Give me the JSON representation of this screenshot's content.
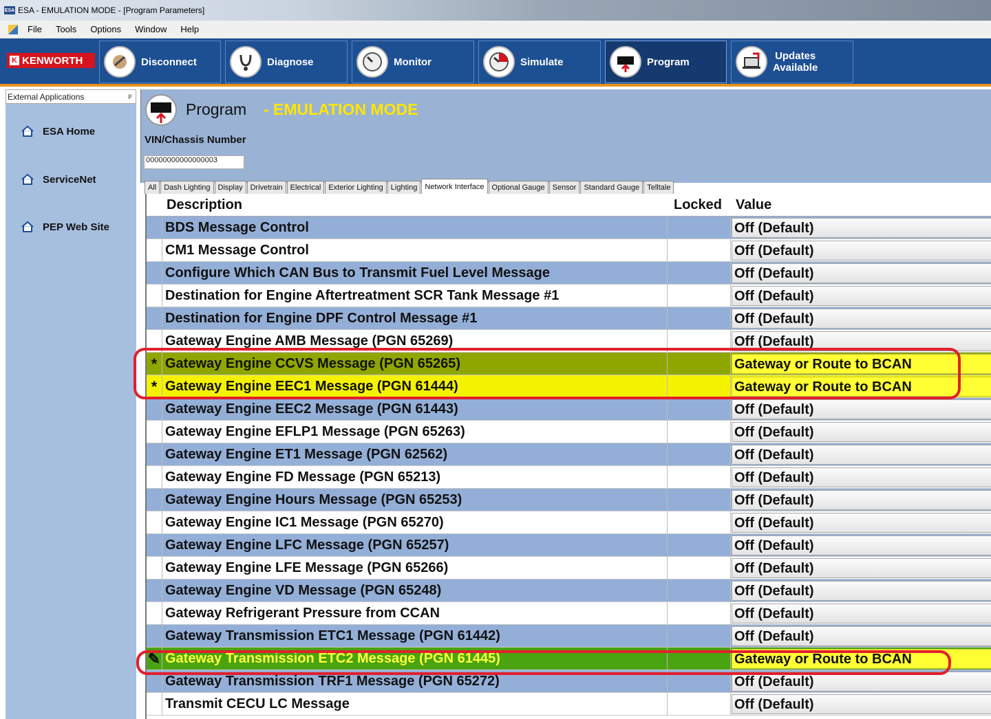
{
  "window": {
    "title": "ESA - EMULATION MODE - [Program Parameters]",
    "app_icon": "ESA"
  },
  "menu": [
    "File",
    "Tools",
    "Options",
    "Window",
    "Help"
  ],
  "toolbar": {
    "brand": "KENWORTH",
    "brand_badge": "K",
    "buttons": [
      {
        "label": "Disconnect",
        "icon": "disconnect-icon"
      },
      {
        "label": "Diagnose",
        "icon": "stethoscope-icon"
      },
      {
        "label": "Monitor",
        "icon": "gauge-icon"
      },
      {
        "label": "Simulate",
        "icon": "simulate-gauge-icon"
      },
      {
        "label": "Program",
        "icon": "chip-icon",
        "active": true
      },
      {
        "label": "Updates Available",
        "label_line1": "Updates",
        "label_line2": "Available",
        "icon": "laptop-update-icon"
      }
    ]
  },
  "sidebar": {
    "header": "External Applications",
    "pin": "ᵖ",
    "links": [
      "ESA Home",
      "ServiceNet",
      "PEP Web Site"
    ]
  },
  "main": {
    "title": "Program",
    "mode": "- EMULATION MODE",
    "vin_label": "VIN/Chassis Number",
    "vin_value": "00000000000000003"
  },
  "tabs": [
    "All",
    "Dash Lighting",
    "Display",
    "Drivetrain",
    "Electrical",
    "Exterior Lighting",
    "Lighting",
    "Network Interface",
    "Optional Gauge",
    "Sensor",
    "Standard Gauge",
    "Telltale"
  ],
  "active_tab": "Network Interface",
  "grid": {
    "columns": {
      "description": "Description",
      "locked": "Locked",
      "value": "Value"
    },
    "rows": [
      {
        "marker": "",
        "description": "BDS Message Control",
        "value": "Off (Default)"
      },
      {
        "marker": "",
        "description": "CM1 Message Control",
        "value": "Off (Default)"
      },
      {
        "marker": "",
        "description": "Configure Which CAN Bus to Transmit Fuel Level Message",
        "value": "Off (Default)"
      },
      {
        "marker": "",
        "description": "Destination for Engine Aftertreatment SCR Tank Message #1",
        "value": "Off (Default)"
      },
      {
        "marker": "",
        "description": "Destination for Engine DPF Control Message #1",
        "value": "Off (Default)"
      },
      {
        "marker": "",
        "description": "Gateway Engine AMB Message (PGN 65269)",
        "value": "Off (Default)"
      },
      {
        "marker": "*",
        "description": "Gateway Engine CCVS Message (PGN 65265)",
        "value": "Gateway or Route to BCAN"
      },
      {
        "marker": "*",
        "description": "Gateway Engine EEC1 Message (PGN 61444)",
        "value": "Gateway or Route to BCAN"
      },
      {
        "marker": "",
        "description": "Gateway Engine EEC2 Message (PGN 61443)",
        "value": "Off (Default)"
      },
      {
        "marker": "",
        "description": "Gateway Engine EFLP1 Message (PGN 65263)",
        "value": "Off (Default)"
      },
      {
        "marker": "",
        "description": "Gateway Engine ET1 Message (PGN 62562)",
        "value": "Off (Default)"
      },
      {
        "marker": "",
        "description": "Gateway Engine FD Message (PGN 65213)",
        "value": "Off (Default)"
      },
      {
        "marker": "",
        "description": "Gateway Engine Hours Message (PGN 65253)",
        "value": "Off (Default)"
      },
      {
        "marker": "",
        "description": "Gateway Engine IC1 Message (PGN 65270)",
        "value": "Off (Default)"
      },
      {
        "marker": "",
        "description": "Gateway Engine LFC Message (PGN 65257)",
        "value": "Off (Default)"
      },
      {
        "marker": "",
        "description": "Gateway Engine LFE Message (PGN 65266)",
        "value": "Off (Default)"
      },
      {
        "marker": "",
        "description": "Gateway Engine VD Message (PGN 65248)",
        "value": "Off (Default)"
      },
      {
        "marker": "",
        "description": "Gateway Refrigerant Pressure from CCAN",
        "value": "Off (Default)"
      },
      {
        "marker": "",
        "description": "Gateway Transmission ETC1 Message (PGN 61442)",
        "value": "Off (Default)"
      },
      {
        "marker": "✎",
        "description": "Gateway Transmission ETC2 Message (PGN 61445)",
        "value": "Gateway or Route to BCAN"
      },
      {
        "marker": "",
        "description": "Gateway Transmission TRF1 Message (PGN 65272)",
        "value": "Off (Default)"
      },
      {
        "marker": "",
        "description": "Transmit CECU LC Message",
        "value": "Off (Default)"
      }
    ]
  },
  "colors": {
    "toolbar": "#1d4f93",
    "accent": "#e8931e",
    "emulation": "#ffe600",
    "annotation": "#e0202c"
  }
}
